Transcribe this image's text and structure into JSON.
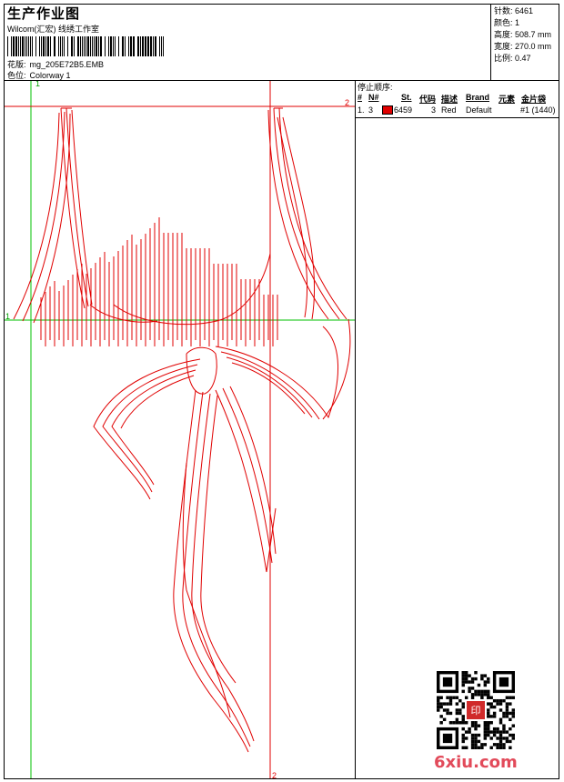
{
  "header": {
    "title": "生产作业图",
    "subtitle": "Wilcom(汇宏) 线绣工作室",
    "design_label": "花版:",
    "design_value": "mg_205E72B5.EMB",
    "colorway_label": "色位:",
    "colorway_value": "Colorway 1"
  },
  "stats": {
    "stitches_label": "针数:",
    "stitches_value": "6461",
    "colors_label": "颜色:",
    "colors_value": "1",
    "height_label": "高度:",
    "height_value": "508.7 mm",
    "width_label": "宽度:",
    "width_value": "270.0 mm",
    "scale_label": "比例:",
    "scale_value": "0.47"
  },
  "stop_panel": {
    "title": "停止顺序:",
    "columns": [
      "#",
      "N#",
      "St.",
      "代码",
      "描述",
      "Brand",
      "元素",
      "金片袋"
    ],
    "row": {
      "index": "1.",
      "needle": "3",
      "stitches": "6459",
      "code": "3",
      "description": "Red",
      "brand": "Default",
      "element": "#1 (1440)",
      "color": "#e00000"
    }
  },
  "guides": {
    "green_label_top": "1",
    "green_label_left": "1",
    "red_label_right": "2",
    "red_label_bottom": "2"
  },
  "watermark": "6xiu.com",
  "qr_seal_text": "印"
}
